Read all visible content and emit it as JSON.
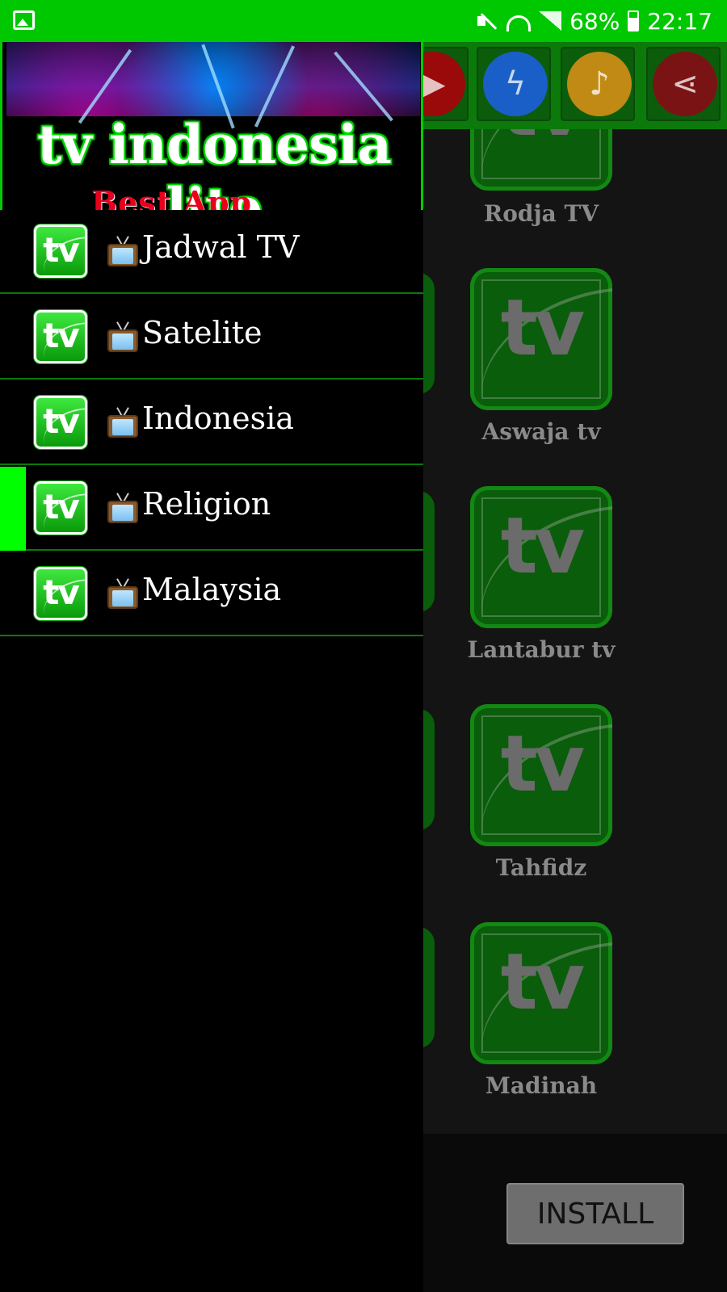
{
  "status_bar": {
    "battery": "68%",
    "time": "22:17",
    "icons": [
      "gallery-icon",
      "mute-icon",
      "wifi-icon",
      "signal-icon",
      "battery-icon"
    ]
  },
  "toolbar": {
    "buttons": [
      {
        "name": "youtube-icon",
        "color": "#a80000"
      },
      {
        "name": "messenger-icon",
        "color": "#1a6ad8"
      },
      {
        "name": "bell-icon",
        "color": "#c88a10"
      },
      {
        "name": "share-icon",
        "color": "#8a1a1a"
      }
    ]
  },
  "channels": [
    {
      "label": "Rodja TV",
      "tile_text": "tv"
    },
    {
      "label": "Aswaja tv",
      "tile_text": "tv"
    },
    {
      "label": "Lantabur tv",
      "tile_text": "tv"
    },
    {
      "label": "Tahfidz",
      "tile_text": "tv"
    },
    {
      "label": "Madinah",
      "tile_text": "tv"
    }
  ],
  "install_label": "INSTALL",
  "drawer": {
    "header_title": "tv indonesia lite",
    "header_subtitle": "Best App Streaming",
    "menu_icon_text": "tv",
    "items": [
      {
        "label": "Jadwal TV",
        "active": false
      },
      {
        "label": "Satelite",
        "active": false
      },
      {
        "label": "Indonesia",
        "active": false
      },
      {
        "label": "Religion",
        "active": true
      },
      {
        "label": "Malaysia",
        "active": false
      }
    ]
  },
  "colors": {
    "status_bar": "#00c800",
    "accent_green": "#00ff00"
  }
}
